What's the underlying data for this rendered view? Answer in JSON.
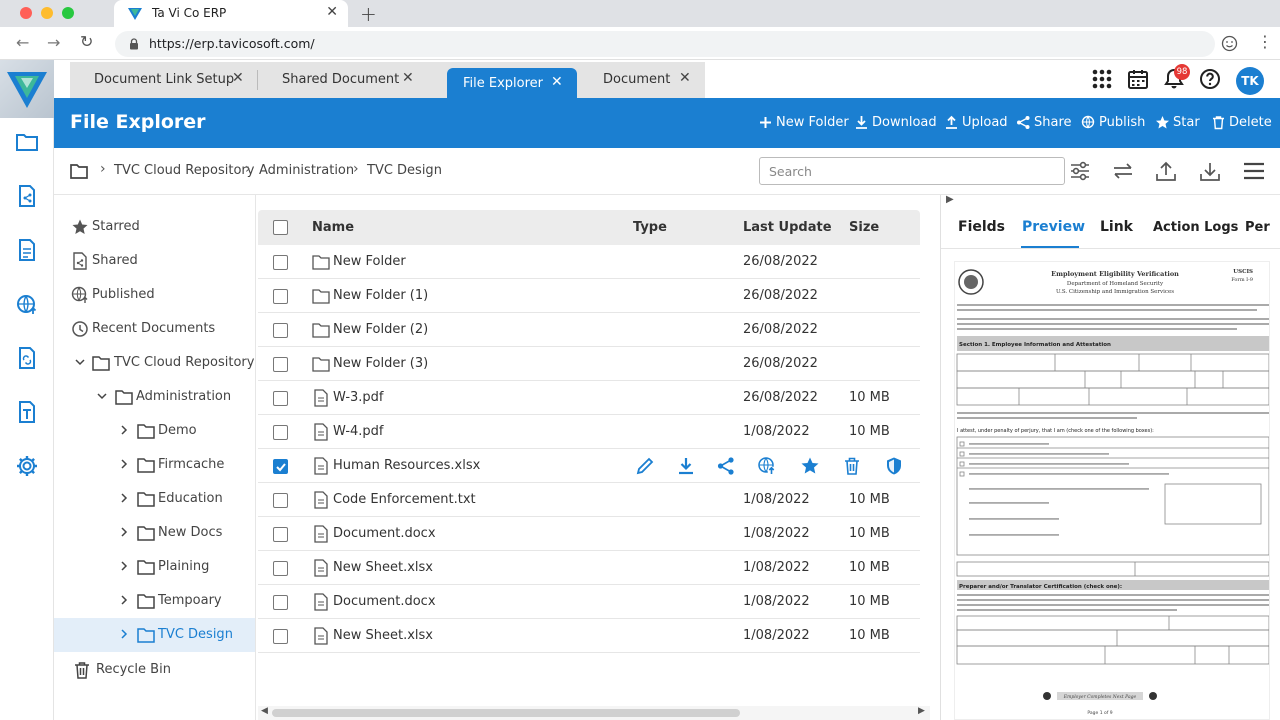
{
  "browser": {
    "tab_title": "Ta Vi Co ERP",
    "url": "https://erp.tavicosoft.com/"
  },
  "app_tabs": [
    {
      "label": "Document Link Setup",
      "active": false
    },
    {
      "label": "Shared Document",
      "active": false
    },
    {
      "label": "File Explorer",
      "active": true
    },
    {
      "label": "Document",
      "active": false
    }
  ],
  "header": {
    "notification_count": "98",
    "user_initials": "TK"
  },
  "titlebar": {
    "title": "File Explorer",
    "actions": [
      "New Folder",
      "Download",
      "Upload",
      "Share",
      "Publish",
      "Star",
      "Delete"
    ]
  },
  "breadcrumb": [
    "TVC Cloud Repository",
    "Administration",
    "TVC Design"
  ],
  "search": {
    "placeholder": "Search",
    "value": ""
  },
  "tree": {
    "quick": [
      "Starred",
      "Shared",
      "Published",
      "Recent Documents"
    ],
    "repository": "TVC Cloud Repository",
    "admin": "Administration",
    "folders": [
      "Demo",
      "Firmcache",
      "Education",
      "New Docs",
      "Plaining",
      "Tempoary",
      "TVC Design"
    ],
    "selected": "TVC Design",
    "recycle": "Recycle Bin"
  },
  "table": {
    "columns": [
      "Name",
      "Type",
      "Last Update",
      "Size"
    ],
    "rows": [
      {
        "name": "New Folder",
        "kind": "folder",
        "date": "26/08/2022",
        "size": "",
        "checked": false
      },
      {
        "name": "New Folder (1)",
        "kind": "folder",
        "date": "26/08/2022",
        "size": "",
        "checked": false
      },
      {
        "name": "New Folder (2)",
        "kind": "folder",
        "date": "26/08/2022",
        "size": "",
        "checked": false
      },
      {
        "name": "New Folder (3)",
        "kind": "folder",
        "date": "26/08/2022",
        "size": "",
        "checked": false
      },
      {
        "name": "W-3.pdf",
        "kind": "file",
        "date": "26/08/2022",
        "size": "10 MB",
        "checked": false
      },
      {
        "name": "W-4.pdf",
        "kind": "file",
        "date": "1/08/2022",
        "size": "10 MB",
        "checked": false
      },
      {
        "name": "Human Resources.xlsx",
        "kind": "file",
        "date": "",
        "size": "",
        "checked": true
      },
      {
        "name": "Code Enforcement.txt",
        "kind": "file",
        "date": "1/08/2022",
        "size": "10 MB",
        "checked": false
      },
      {
        "name": "Document.docx",
        "kind": "file",
        "date": "1/08/2022",
        "size": "10 MB",
        "checked": false
      },
      {
        "name": "New Sheet.xlsx",
        "kind": "file",
        "date": "1/08/2022",
        "size": "10 MB",
        "checked": false
      },
      {
        "name": "Document.docx",
        "kind": "file",
        "date": "1/08/2022",
        "size": "10 MB",
        "checked": false
      },
      {
        "name": "New Sheet.xlsx",
        "kind": "file",
        "date": "1/08/2022",
        "size": "10 MB",
        "checked": false
      }
    ],
    "row_actions": [
      "edit-icon",
      "download-icon",
      "share-icon",
      "publish-icon",
      "star-icon",
      "delete-icon",
      "shield-icon"
    ]
  },
  "right_panel": {
    "tabs": [
      "Fields",
      "Preview",
      "Link",
      "Action Logs",
      "Per"
    ],
    "active_tab": "Preview",
    "doc": {
      "title": "Employment Eligibility Verification",
      "dept": "Department of Homeland Security",
      "agency": "U.S. Citizenship and Immigration Services",
      "form": "USCIS",
      "form_no": "Form I-9",
      "section1": "Section 1. Employee Information and Attestation",
      "attest": "I attest, under penalty of perjury, that I am (check one of the following boxes):",
      "preparer": "Preparer and/or Translator Certification (check one):",
      "footer": "Employer Completes Next Page",
      "page": "Page 1 of 9"
    }
  },
  "colors": {
    "primary": "#1b7fd1",
    "badge": "#e53935"
  }
}
